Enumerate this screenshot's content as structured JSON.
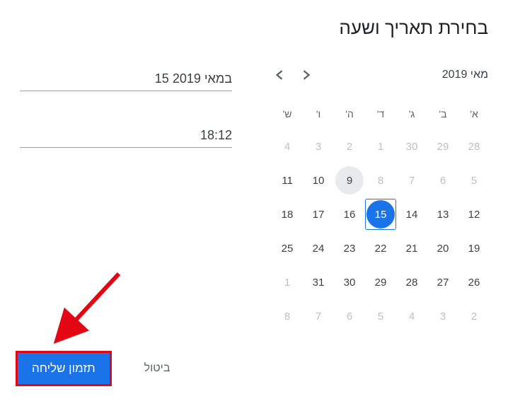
{
  "title": "בחירת תאריך ושעה",
  "calendar": {
    "month_label": "מאי 2019",
    "days_of_week": [
      "א'",
      "ב'",
      "ג'",
      "ד'",
      "ה'",
      "ו'",
      "ש'"
    ],
    "cells": [
      {
        "n": 28,
        "other": true
      },
      {
        "n": 29,
        "other": true
      },
      {
        "n": 30,
        "other": true
      },
      {
        "n": 1,
        "other": true
      },
      {
        "n": 2,
        "other": true
      },
      {
        "n": 3,
        "other": true
      },
      {
        "n": 4,
        "other": true
      },
      {
        "n": 5,
        "other": true
      },
      {
        "n": 6,
        "other": true
      },
      {
        "n": 7,
        "other": true
      },
      {
        "n": 8,
        "other": true
      },
      {
        "n": 9,
        "today": true
      },
      {
        "n": 10
      },
      {
        "n": 11
      },
      {
        "n": 12
      },
      {
        "n": 13
      },
      {
        "n": 14
      },
      {
        "n": 15,
        "selected": true
      },
      {
        "n": 16
      },
      {
        "n": 17
      },
      {
        "n": 18
      },
      {
        "n": 19
      },
      {
        "n": 20
      },
      {
        "n": 21
      },
      {
        "n": 22
      },
      {
        "n": 23
      },
      {
        "n": 24
      },
      {
        "n": 25
      },
      {
        "n": 26
      },
      {
        "n": 27
      },
      {
        "n": 28
      },
      {
        "n": 29
      },
      {
        "n": 30
      },
      {
        "n": 31
      },
      {
        "n": 1,
        "other": true
      },
      {
        "n": 2,
        "other": true
      },
      {
        "n": 3,
        "other": true
      },
      {
        "n": 4,
        "other": true
      },
      {
        "n": 5,
        "other": true
      },
      {
        "n": 6,
        "other": true
      },
      {
        "n": 7,
        "other": true
      },
      {
        "n": 8,
        "other": true
      }
    ]
  },
  "fields": {
    "date_value": "15 במאי 2019",
    "time_value": "18:12"
  },
  "buttons": {
    "cancel": "ביטול",
    "schedule": "תזמון שליחה"
  }
}
